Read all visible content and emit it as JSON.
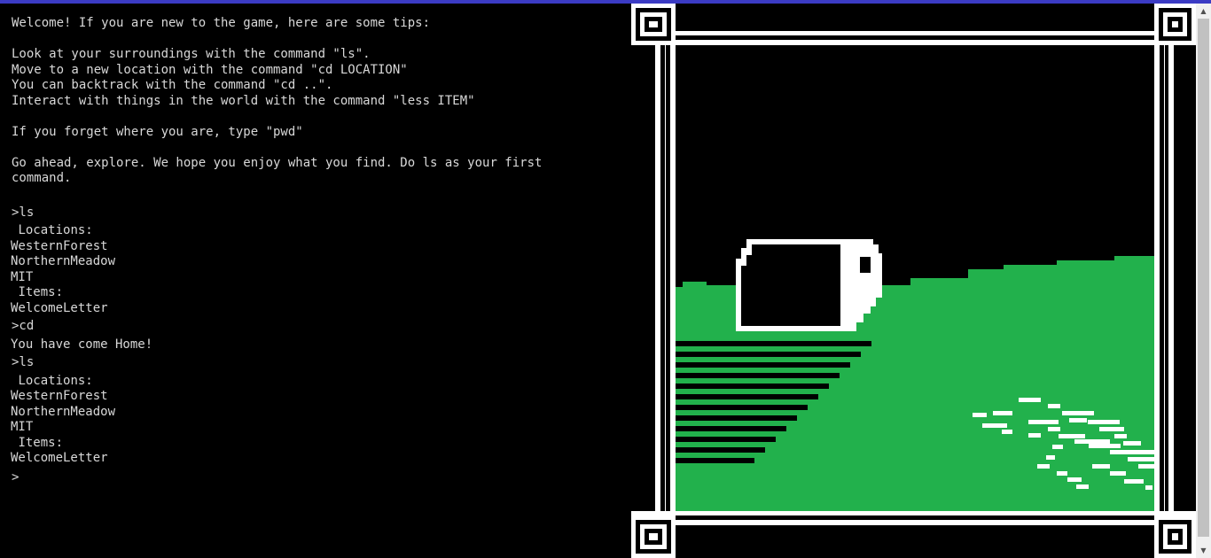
{
  "terminal": {
    "intro": [
      "Welcome! If you are new to the game, here are some tips:",
      "Look at your surroundings with the command \"ls\".\nMove to a new location with the command \"cd LOCATION\"\nYou can backtrack with the command \"cd ..\".\nInteract with things in the world with the command \"less ITEM\"",
      "If you forget where you are, type \"pwd\"",
      "Go ahead, explore. We hope you enjoy what you find. Do ls as your first\ncommand."
    ],
    "history": [
      {
        "command": ">ls",
        "output": " Locations:\nWesternForest\nNorthernMeadow\nMIT\n Items:\nWelcomeLetter"
      },
      {
        "command": ">cd",
        "output": "You have come Home!"
      },
      {
        "command": ">ls",
        "output": " Locations:\nWesternForest\nNorthernMeadow\nMIT\n Items:\nWelcomeLetter"
      }
    ],
    "prompt": ">"
  },
  "scene": {
    "colors": {
      "grass": "#22b14c",
      "frame": "#ffffff",
      "background": "#000000"
    }
  },
  "scrollbar": {
    "up_icon": "▲",
    "down_icon": "▼"
  }
}
